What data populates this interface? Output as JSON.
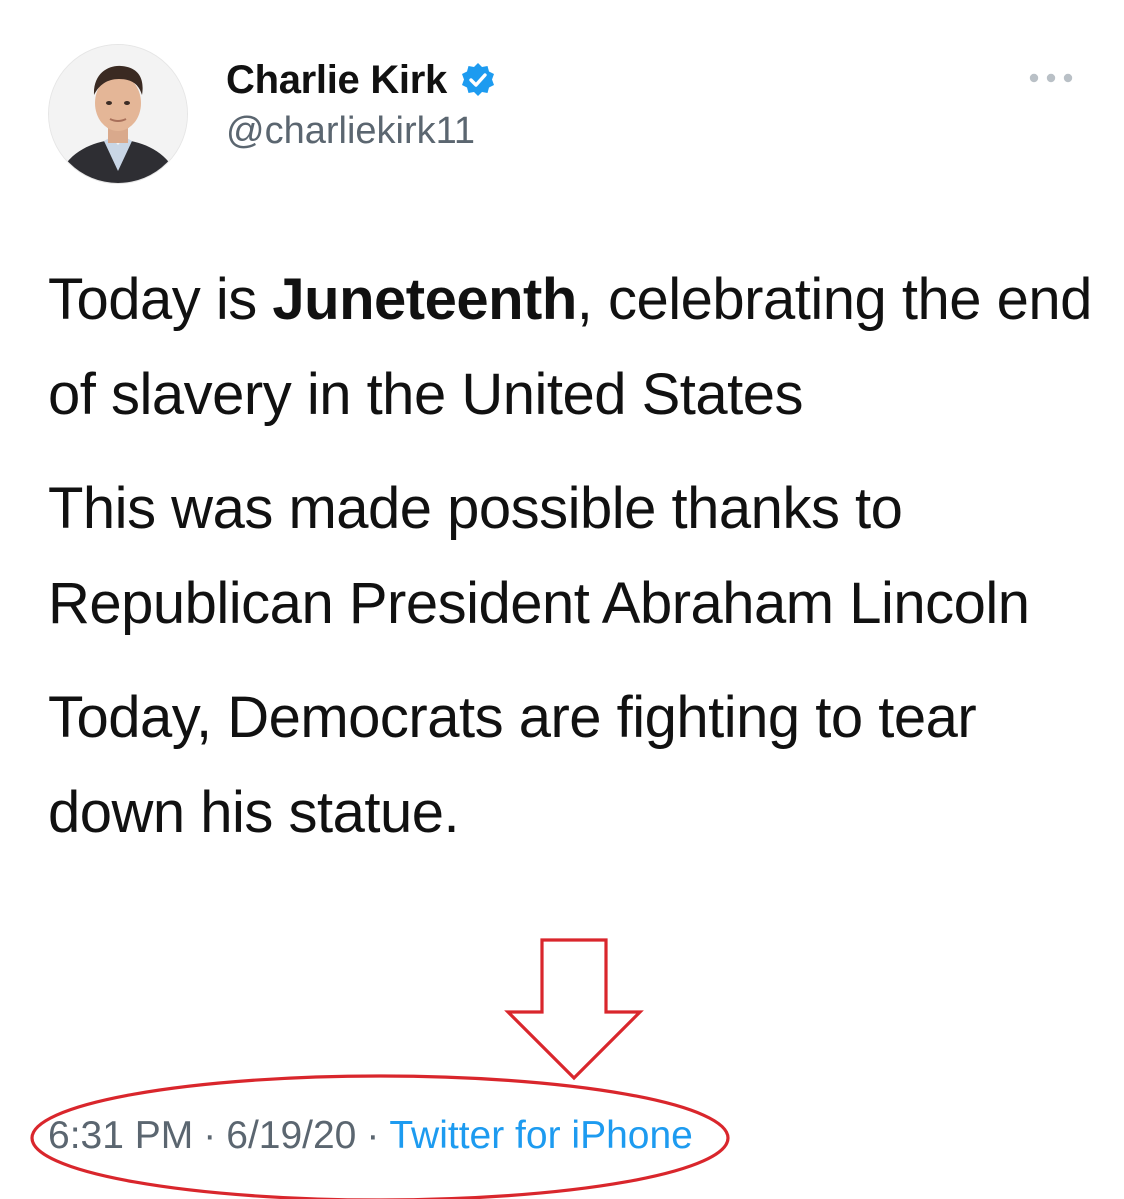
{
  "user": {
    "display_name": "Charlie Kirk",
    "handle": "@charliekirk11",
    "verified": true,
    "avatar_icon": "profile-photo"
  },
  "menu": {
    "icon": "more-options-icon"
  },
  "tweet": {
    "p1_before": "Today is ",
    "p1_bold": "Juneteenth",
    "p1_after": ", celebrating the end of slavery in the United States",
    "p2": "This was made possible thanks to Republican President Abraham Lincoln",
    "p3": "Today, Democrats are fighting to tear down his statue."
  },
  "meta": {
    "time": "6:31 PM",
    "date": "6/19/20",
    "separator": "·",
    "source": "Twitter for iPhone"
  },
  "colors": {
    "verified_blue": "#1d9bf0",
    "link_blue": "#1d9bf0",
    "annotation_red": "#d9262c",
    "muted_text": "#5b6670"
  }
}
